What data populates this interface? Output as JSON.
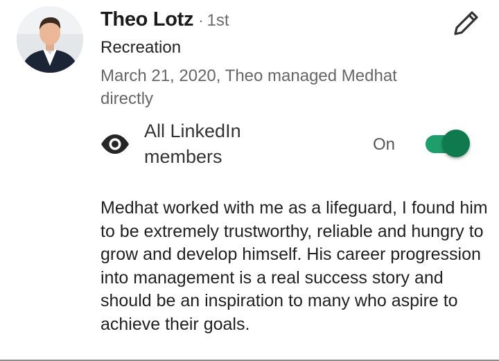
{
  "recommender": {
    "name": "Theo Lotz",
    "degree_separator": "·",
    "degree": "1st",
    "headline": "Recreation",
    "relationship": "March 21, 2020, Theo managed Medhat directly",
    "avatar_icon": "profile-photo"
  },
  "actions": {
    "edit_icon": "pencil-icon"
  },
  "visibility": {
    "icon": "eye-icon",
    "label": "All LinkedIn members",
    "toggle_label": "On",
    "toggle_on": true,
    "accent_color": "#0e7a4e"
  },
  "recommendation": {
    "text": "Medhat worked with me as a lifeguard, I found him to be extremely trustworthy, reliable and hungry to grow and develop himself. His career progression into management is a real success story and should be an inspiration to many who aspire to achieve their goals."
  }
}
